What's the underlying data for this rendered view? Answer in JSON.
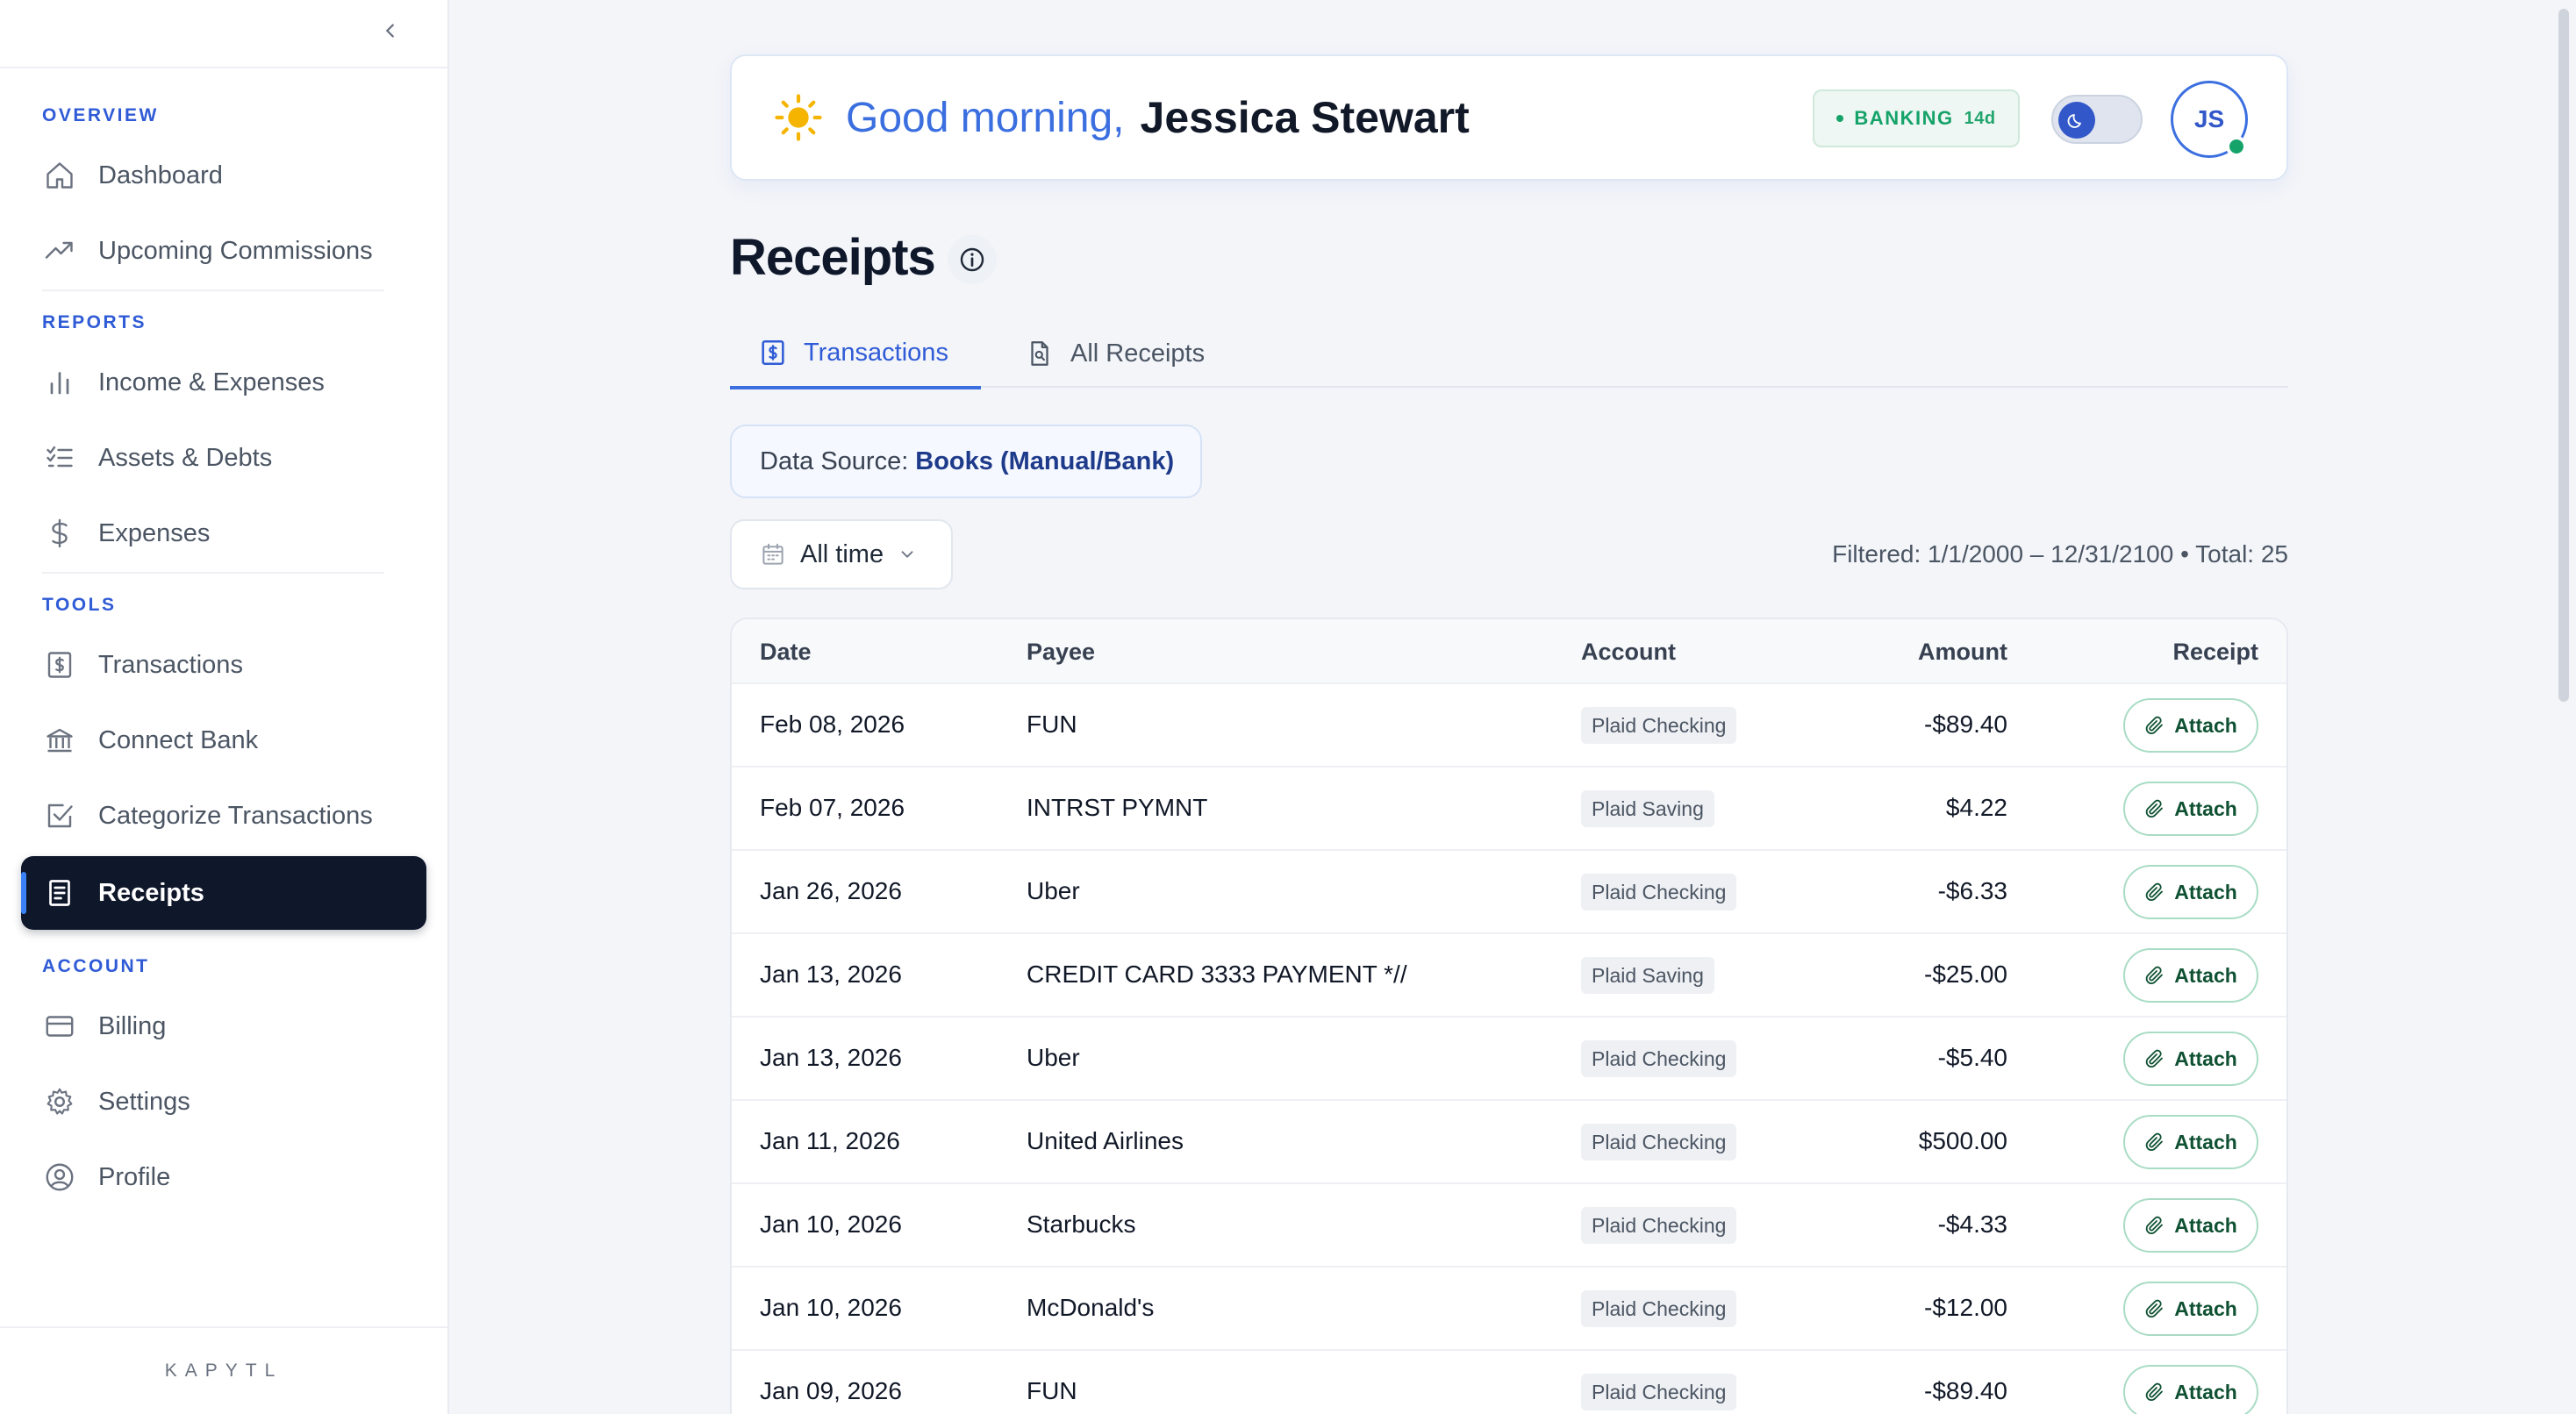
{
  "sidebar": {
    "sections": {
      "overview": "OVERVIEW",
      "reports": "REPORTS",
      "tools": "TOOLS",
      "account": "ACCOUNT"
    },
    "items": {
      "dashboard": "Dashboard",
      "upcoming": "Upcoming Commissions",
      "income": "Income & Expenses",
      "assets": "Assets & Debts",
      "expenses": "Expenses",
      "transactions": "Transactions",
      "connect": "Connect Bank",
      "categorize": "Categorize Transactions",
      "receipts": "Receipts",
      "billing": "Billing",
      "settings": "Settings",
      "profile": "Profile"
    },
    "brand": "KAPYTL"
  },
  "header": {
    "greeting": "Good morning,",
    "name": "Jessica Stewart",
    "badge_label": "BANKING",
    "badge_days": "14d",
    "avatar_initials": "JS"
  },
  "page": {
    "title": "Receipts",
    "tabs": [
      "Transactions",
      "All Receipts"
    ],
    "data_source_label": "Data Source:",
    "data_source_value": "Books (Manual/Bank)",
    "range": "All time",
    "filter_text": "Filtered: 1/1/2000 – 12/31/2100 • Total: 25"
  },
  "table": {
    "columns": [
      "Date",
      "Payee",
      "Account",
      "Amount",
      "Receipt"
    ],
    "attach_label": "Attach",
    "rows": [
      {
        "date": "Feb 08, 2026",
        "payee": "FUN",
        "account": "Plaid Checking",
        "amount": "-$89.40"
      },
      {
        "date": "Feb 07, 2026",
        "payee": "INTRST PYMNT",
        "account": "Plaid Saving",
        "amount": "$4.22"
      },
      {
        "date": "Jan 26, 2026",
        "payee": "Uber",
        "account": "Plaid Checking",
        "amount": "-$6.33"
      },
      {
        "date": "Jan 13, 2026",
        "payee": "CREDIT CARD 3333 PAYMENT *//",
        "account": "Plaid Saving",
        "amount": "-$25.00"
      },
      {
        "date": "Jan 13, 2026",
        "payee": "Uber",
        "account": "Plaid Checking",
        "amount": "-$5.40"
      },
      {
        "date": "Jan 11, 2026",
        "payee": "United Airlines",
        "account": "Plaid Checking",
        "amount": "$500.00"
      },
      {
        "date": "Jan 10, 2026",
        "payee": "Starbucks",
        "account": "Plaid Checking",
        "amount": "-$4.33"
      },
      {
        "date": "Jan 10, 2026",
        "payee": "McDonald's",
        "account": "Plaid Checking",
        "amount": "-$12.00"
      },
      {
        "date": "Jan 09, 2026",
        "payee": "FUN",
        "account": "Plaid Checking",
        "amount": "-$89.40"
      }
    ]
  },
  "colors": {
    "accent": "#3b6fe0",
    "active_nav": "#0f172a",
    "success": "#16a36a"
  }
}
